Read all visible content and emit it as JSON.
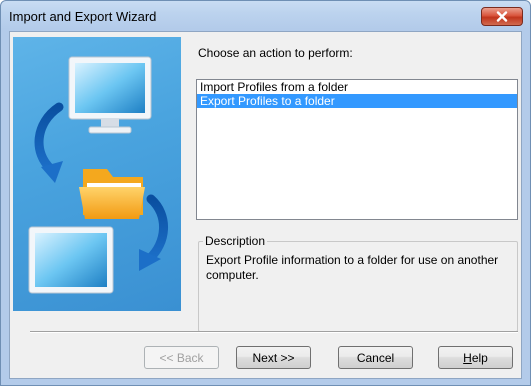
{
  "window": {
    "title": "Import and Export Wizard"
  },
  "icons": {
    "close": "close-icon",
    "computer_top": "computer-icon",
    "folder": "folder-icon",
    "computer_bottom": "computer-icon",
    "arrows": "curved-arrow-icon"
  },
  "prompt": "Choose an action to perform:",
  "actions": [
    {
      "label": "Import Profiles from a folder",
      "selected": false
    },
    {
      "label": "Export Profiles to a folder",
      "selected": true
    }
  ],
  "description": {
    "title": "Description",
    "text": "Export Profile information to a folder for use on another computer."
  },
  "buttons": {
    "back": "<< Back",
    "next": "Next >>",
    "cancel": "Cancel",
    "help_prefix": "",
    "help_accel": "H",
    "help_rest": "elp"
  },
  "colors": {
    "selection": "#3399ff",
    "close_button": "#c1351d",
    "titlebar": "#bcd3ee"
  }
}
